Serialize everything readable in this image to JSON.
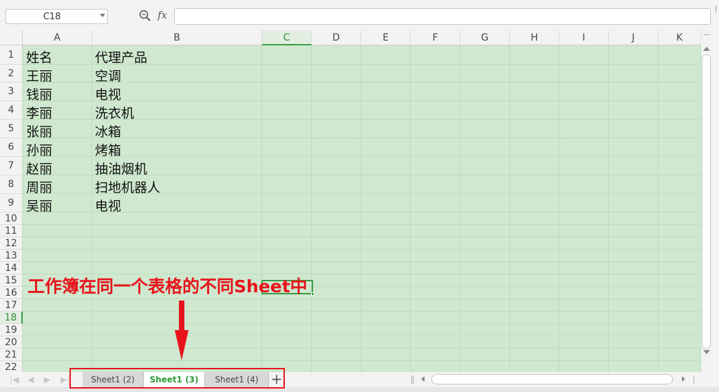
{
  "formula_bar": {
    "name_box": "C18",
    "fx_label": "fx",
    "formula_value": ""
  },
  "columns": [
    "A",
    "B",
    "C",
    "D",
    "E",
    "F",
    "G",
    "H",
    "I",
    "J",
    "K"
  ],
  "active_column": "C",
  "rows": [
    "1",
    "2",
    "3",
    "4",
    "5",
    "6",
    "7",
    "8",
    "9",
    "10",
    "11",
    "12",
    "13",
    "14",
    "15",
    "16",
    "17",
    "18",
    "19",
    "20",
    "21",
    "22"
  ],
  "active_row": "18",
  "cells": [
    {
      "a": "姓名",
      "b": "代理产品"
    },
    {
      "a": "王丽",
      "b": "空调"
    },
    {
      "a": "钱丽",
      "b": "电视"
    },
    {
      "a": "李丽",
      "b": "洗衣机"
    },
    {
      "a": "张丽",
      "b": "冰箱"
    },
    {
      "a": "孙丽",
      "b": "烤箱"
    },
    {
      "a": "赵丽",
      "b": "抽油烟机"
    },
    {
      "a": "周丽",
      "b": "扫地机器人"
    },
    {
      "a": "吴丽",
      "b": "电视"
    }
  ],
  "annotation": {
    "text": "工作簿在同一个表格的不同Sheet中",
    "color": "#e8141c"
  },
  "sheet_tabs": [
    {
      "label": "Sheet1 (2)",
      "active": false
    },
    {
      "label": "Sheet1 (3)",
      "active": true
    },
    {
      "label": "Sheet1 (4)",
      "active": false
    }
  ],
  "add_sheet_label": "+",
  "accent_color": "#3a9a45",
  "sheet_background": "#cfe8cf"
}
